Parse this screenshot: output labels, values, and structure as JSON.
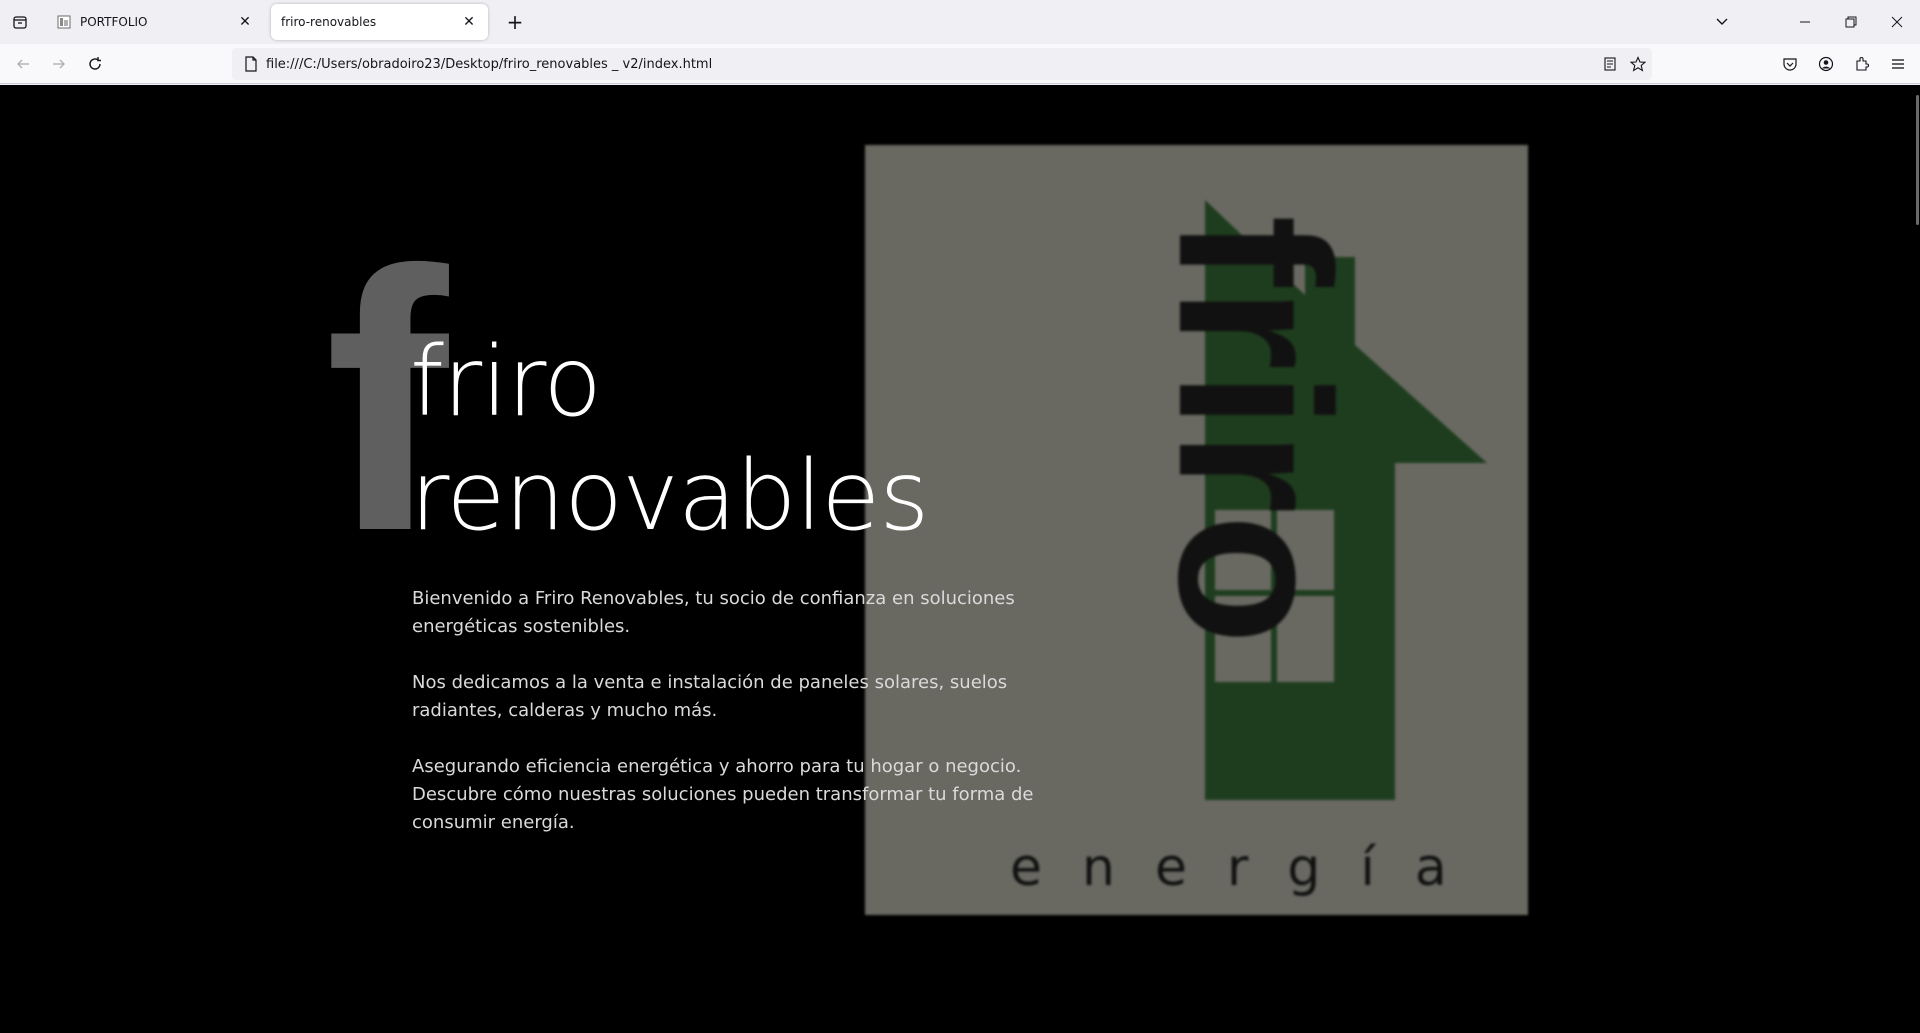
{
  "browser": {
    "tabs": [
      {
        "title": "PORTFOLIO",
        "active": false
      },
      {
        "title": "friro-renovables",
        "active": true
      }
    ],
    "url": "file:///C:/Users/obradoiro23/Desktop/friro_renovables _ v2/index.html",
    "icons": {
      "tab_list": "firefox-view-icon",
      "new_tab": "plus-icon",
      "list_all_tabs": "chevron-down-icon",
      "back": "back-arrow-icon",
      "forward": "forward-arrow-icon",
      "reload": "reload-icon",
      "page": "page-icon",
      "reader": "reader-mode-icon",
      "bookmark": "star-icon",
      "pocket": "pocket-icon",
      "account": "account-icon",
      "extensions": "extensions-icon",
      "menu": "hamburger-menu-icon"
    }
  },
  "page": {
    "background": "#000000",
    "decorative_letter": "f",
    "title_line1": "friro",
    "title_line2": "renovables",
    "paragraphs": [
      "Bienvenido a Friro Renovables, tu socio de confianza en soluciones energéticas sostenibles.",
      "Nos dedicamos a la venta e instalación de paneles solares, suelos radiantes, calderas y mucho más.",
      "Asegurando eficiencia energética y ahorro para tu hogar o negocio. Descubre cómo nuestras soluciones pueden transformar tu forma de consumir energía."
    ],
    "logo": {
      "wordmark": "friro",
      "tagline": "energía",
      "colors": {
        "panel": "#696962",
        "house": "#1e3d1e",
        "text": "#111111"
      }
    }
  }
}
